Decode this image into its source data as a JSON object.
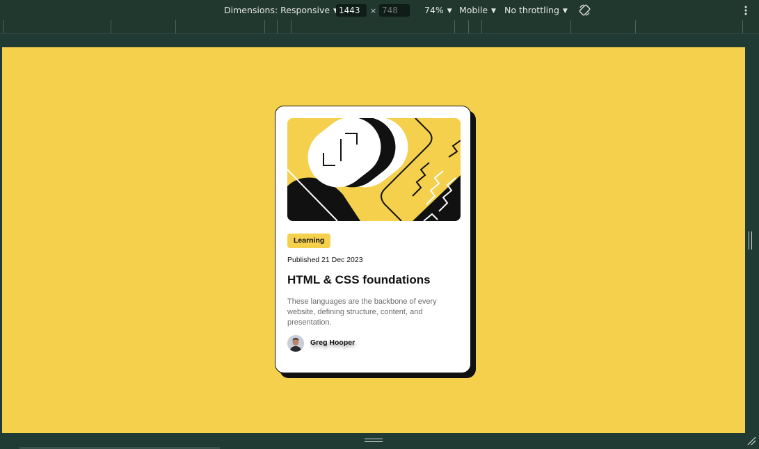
{
  "devtools": {
    "dimensions_label": "Dimensions: Responsive",
    "width_value": "1443",
    "height_placeholder": "748",
    "times_sign": "×",
    "zoom": "74%",
    "device_type": "Mobile",
    "throttling": "No throttling",
    "icons": {
      "caret": "chevron-down-icon",
      "rotate": "rotate-device-icon",
      "more": "more-options-icon"
    }
  },
  "page": {
    "background_color": "#f4d04d",
    "card": {
      "category": "Learning",
      "published": "Published 21 Dec 2023",
      "title": "HTML & CSS foundations",
      "description": "These languages are the backbone of every website, defining structure, content, and presentation.",
      "author_name": "Greg Hooper"
    }
  }
}
